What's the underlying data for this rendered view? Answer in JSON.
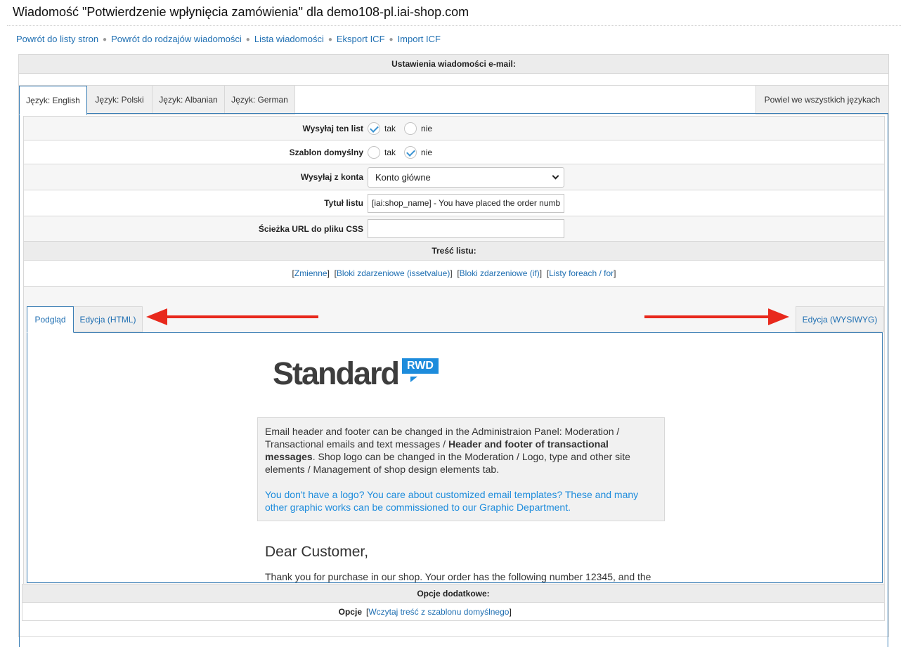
{
  "page": {
    "title": "Wiadomość \"Potwierdzenie wpłynięcia zamówienia\" dla demo108-pl.iai-shop.com"
  },
  "nav": {
    "items": [
      "Powrót do listy stron",
      "Powrót do rodzajów wiadomości",
      "Lista wiadomości",
      "Eksport ICF",
      "Import ICF"
    ]
  },
  "panel": {
    "title": "Ustawienia wiadomości e-mail:"
  },
  "lang_tabs": {
    "tabs": [
      "Język: English",
      "Język: Polski",
      "Język: Albanian",
      "Język: German"
    ],
    "active": 0,
    "repeat_all": "Powiel we wszystkich językach"
  },
  "form": {
    "send_letter": {
      "label": "Wysyłaj ten list",
      "yes": "tak",
      "no": "nie",
      "value": "tak"
    },
    "default_template": {
      "label": "Szablon domyślny",
      "yes": "tak",
      "no": "nie",
      "value": "nie"
    },
    "send_from": {
      "label": "Wysyłaj z konta",
      "value": "Konto główne"
    },
    "subject": {
      "label": "Tytuł listu",
      "value": "[iai:shop_name] - You have placed the order numb"
    },
    "css_path": {
      "label": "Ścieżka URL do pliku CSS",
      "value": ""
    }
  },
  "content": {
    "header": "Treść listu:",
    "links": [
      "Zmienne",
      "Bloki zdarzeniowe (issetvalue)",
      "Bloki zdarzeniowe (if)",
      "Listy foreach / for"
    ]
  },
  "editor": {
    "tabs": [
      "Podgląd",
      "Edycja (HTML)"
    ],
    "active": 0,
    "wysiwyg": "Edycja (WYSIWYG)",
    "arrow_color": "#e8291c"
  },
  "preview": {
    "logo_text": "Standard",
    "logo_badge": "RWD",
    "info_part1": "Email header and footer can be changed in the Administraion Panel: Moderation / Transactional emails and text messages / ",
    "info_bold": "Header and footer of transactional messages",
    "info_part2": ". Shop logo can be changed in the Moderation / Logo, type and other site elements / Management of shop design elements tab.",
    "info_blue": "You don't have a logo? You care about customized email templates? These and many other graphic works can be commissioned to our Graphic Department.",
    "greeting": "Dear Customer,",
    "thank_you": "Thank you for purchase in our shop. Your order has the following number 12345, and the"
  },
  "options": {
    "header": "Opcje dodatkowe:",
    "label": "Opcje",
    "link": "Wczytaj treść z szablonu domyślnego"
  }
}
